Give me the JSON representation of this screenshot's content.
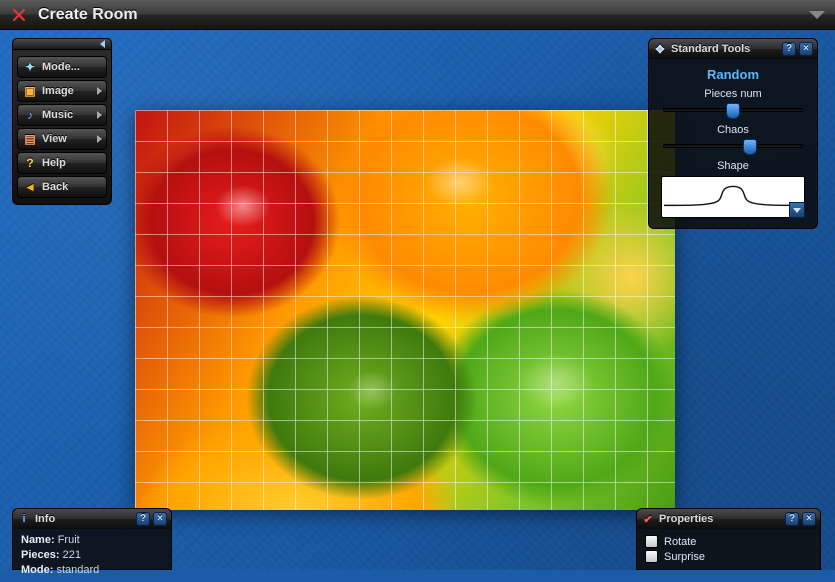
{
  "titlebar": {
    "title": "Create Room"
  },
  "sidebar": {
    "items": [
      {
        "label": "Mode...",
        "icon": "✦",
        "arrow": false
      },
      {
        "label": "Image",
        "icon": "▣",
        "arrow": true
      },
      {
        "label": "Music",
        "icon": "♪",
        "arrow": true
      },
      {
        "label": "View",
        "icon": "▤",
        "arrow": true
      },
      {
        "label": "Help",
        "icon": "?",
        "arrow": false
      },
      {
        "label": "Back",
        "icon": "◄",
        "arrow": false
      }
    ]
  },
  "tools": {
    "title": "Standard Tools",
    "subtitle": "Random",
    "pieces_label": "Pieces num",
    "pieces_pct": 50,
    "chaos_label": "Chaos",
    "chaos_pct": 62,
    "shape_label": "Shape"
  },
  "info": {
    "title": "Info",
    "rows": [
      {
        "k": "Name:",
        "v": "Fruit"
      },
      {
        "k": "Pieces:",
        "v": "221"
      },
      {
        "k": "Mode:",
        "v": "standard"
      }
    ]
  },
  "props": {
    "title": "Properties",
    "items": [
      {
        "label": "Rotate",
        "checked": false
      },
      {
        "label": "Surprise",
        "checked": false
      }
    ]
  }
}
